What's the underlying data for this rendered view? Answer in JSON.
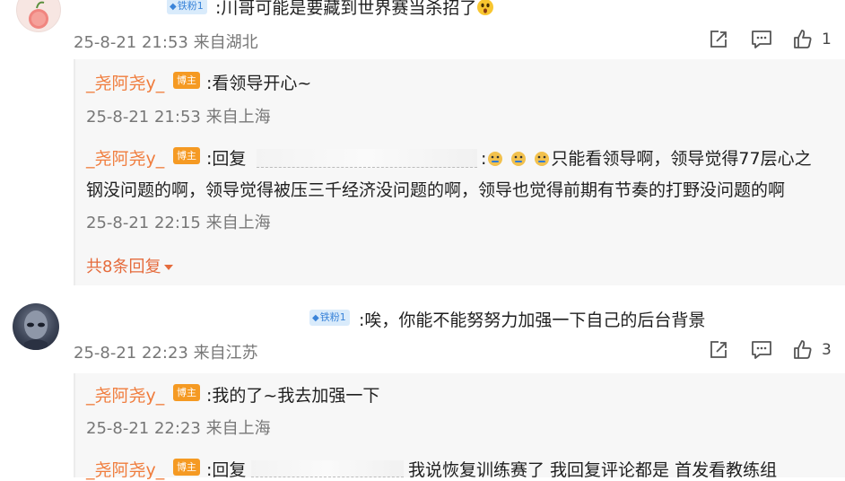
{
  "comment1": {
    "badge": "铁粉1",
    "text": ":川哥可能是要藏到世界赛当杀招了",
    "time": "25-8-21 21:53",
    "location": "来自湖北",
    "likes": "1",
    "emoji_icon": "astonished-emoji"
  },
  "thread1": {
    "reply1": {
      "username": "_尧阿尧y_",
      "host_badge": "博主",
      "text": ":看领导开心~",
      "time": "25-8-21 21:53",
      "location": "来自上海"
    },
    "reply2": {
      "username": "_尧阿尧y_",
      "host_badge": "博主",
      "prefix": ":回复",
      "text_line1": "只能看领导啊，领导觉得77层心之",
      "text_line2": "钢没问题的啊，领导觉得被压三千经济没问题的啊，领导也觉得前期有节奏的打野没问题的啊",
      "time": "25-8-21 22:15",
      "location": "来自上海",
      "emoji_icon": "doge-emoji"
    },
    "more_replies": "共8条回复"
  },
  "comment2": {
    "badge": "铁粉1",
    "text": ":唉，你能不能努努力加强一下自己的后台背景",
    "time": "25-8-21 22:23",
    "location": "来自江苏",
    "likes": "3"
  },
  "thread2": {
    "reply1": {
      "username": "_尧阿尧y_",
      "host_badge": "博主",
      "text": ":我的了~我去加强一下",
      "time": "25-8-21 22:23",
      "location": "来自上海"
    },
    "reply2": {
      "username": "_尧阿尧y_",
      "host_badge": "博主",
      "prefix": ":回复",
      "text": "我说恢复训练赛了  我回复评论都是  首发看教练组"
    }
  },
  "colors": {
    "username": "#f07c3c",
    "host_badge": "#f59a23",
    "fan_badge_bg": "#d9ebfb",
    "fan_badge_text": "#3a84d9",
    "more_link": "#e56b3c"
  }
}
